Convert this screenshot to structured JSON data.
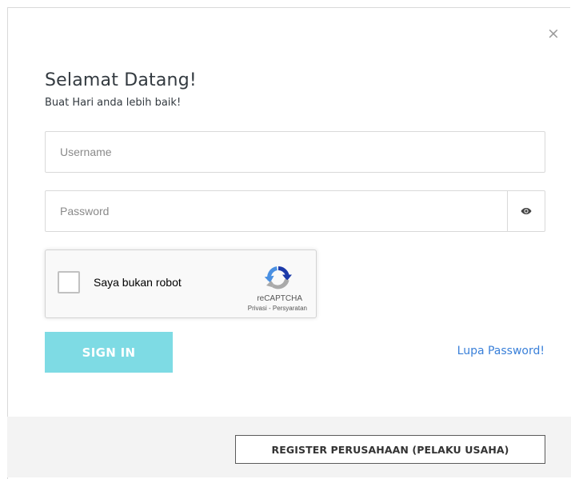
{
  "modal": {
    "close_symbol": "×",
    "title": "Selamat Datang!",
    "subtitle": "Buat Hari anda lebih baik!"
  },
  "form": {
    "username": {
      "placeholder": "Username",
      "value": ""
    },
    "password": {
      "placeholder": "Password",
      "value": "",
      "toggle_icon": "eye-icon"
    }
  },
  "captcha": {
    "label": "Saya bukan robot",
    "brand": "reCAPTCHA",
    "privacy": "Privasi",
    "separator": " - ",
    "terms": "Persyaratan",
    "checked": false
  },
  "actions": {
    "signin_label": "SIGN IN",
    "forgot_label": "Lupa Password!",
    "register_label": "REGISTER PERUSAHAAN (PELAKU USAHA)"
  },
  "colors": {
    "signin_bg": "#7edbe4",
    "link": "#3a80d9",
    "footer_bg": "#f3f3f3"
  }
}
